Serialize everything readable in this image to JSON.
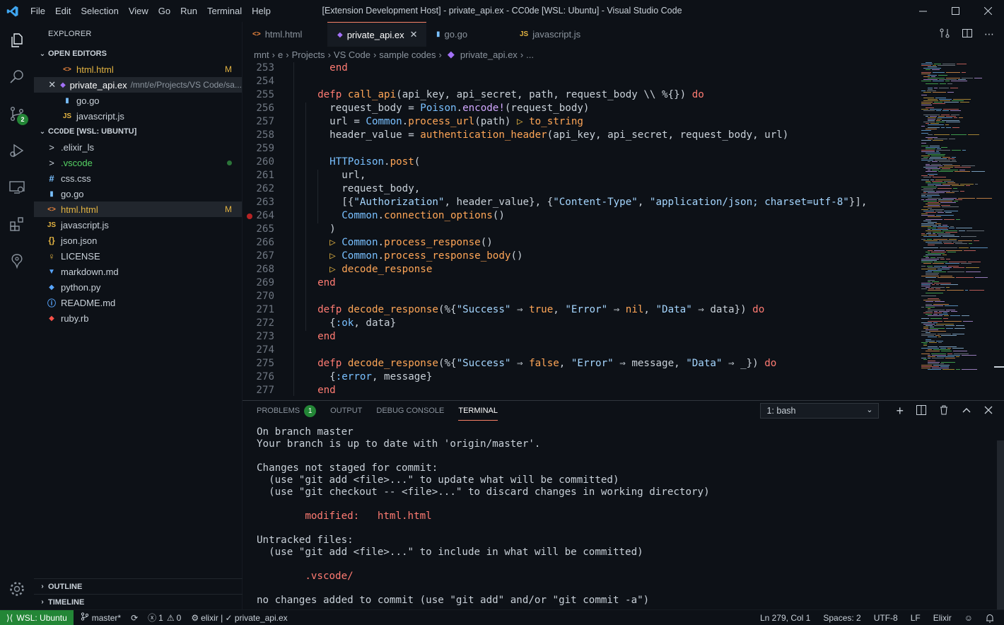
{
  "titlebar": {
    "menu": [
      "File",
      "Edit",
      "Selection",
      "View",
      "Go",
      "Run",
      "Terminal",
      "Help"
    ],
    "title": "[Extension Development Host] - private_api.ex - CC0de [WSL: Ubuntu] - Visual Studio Code"
  },
  "activity": {
    "scm_badge": "2"
  },
  "sidebar": {
    "title": "EXPLORER",
    "open_editors": {
      "label": "OPEN EDITORS",
      "items": [
        {
          "icon": "<>",
          "name": "html.html",
          "badge": "M"
        },
        {
          "icon": "◆",
          "name": "private_api.ex",
          "path": "/mnt/e/Projects/VS Code/sa..."
        },
        {
          "icon": "▮",
          "name": "go.go"
        },
        {
          "icon": "JS",
          "name": "javascript.js"
        }
      ]
    },
    "workspace": {
      "label": "CC0DE [WSL: UBUNTU]",
      "items": [
        {
          "icon": ">",
          "name": ".elixir_ls"
        },
        {
          "icon": ">",
          "name": ".vscode"
        },
        {
          "icon": "#",
          "name": "css.css"
        },
        {
          "icon": "▮",
          "name": "go.go"
        },
        {
          "icon": "<>",
          "name": "html.html",
          "badge": "M"
        },
        {
          "icon": "JS",
          "name": "javascript.js"
        },
        {
          "icon": "{}",
          "name": "json.json"
        },
        {
          "icon": "♀",
          "name": "LICENSE"
        },
        {
          "icon": "▼",
          "name": "markdown.md"
        },
        {
          "icon": "◆",
          "name": "python.py"
        },
        {
          "icon": "ⓘ",
          "name": "README.md"
        },
        {
          "icon": "◆",
          "name": "ruby.rb"
        }
      ]
    },
    "outline": "OUTLINE",
    "timeline": "TIMELINE"
  },
  "tabs": [
    {
      "icon": "<>",
      "label": "html.html"
    },
    {
      "icon": "◆",
      "label": "private_api.ex",
      "close": "✕"
    },
    {
      "icon": "▮",
      "label": "go.go"
    },
    {
      "icon": "JS",
      "label": "javascript.js"
    }
  ],
  "breadcrumbs": [
    "mnt",
    "e",
    "Projects",
    "VS Code",
    "sample codes",
    "private_api.ex",
    "..."
  ],
  "editor": {
    "line_numbers": [
      "253",
      "254",
      "255",
      "256",
      "257",
      "258",
      "259",
      "260",
      "261",
      "262",
      "263",
      "264",
      "265",
      "266",
      "267",
      "268",
      "269",
      "270",
      "271",
      "272",
      "273",
      "274",
      "275",
      "276",
      "277"
    ]
  },
  "panel": {
    "tabs": [
      "PROBLEMS",
      "OUTPUT",
      "DEBUG CONSOLE",
      "TERMINAL"
    ],
    "problems_count": "1",
    "terminal_select": "1: bash",
    "terminal_lines": [
      "On branch master",
      "Your branch is up to date with 'origin/master'.",
      "",
      "Changes not staged for commit:",
      "  (use \"git add <file>...\" to update what will be committed)",
      "  (use \"git checkout -- <file>...\" to discard changes in working directory)",
      "",
      "        modified:   html.html",
      "",
      "Untracked files:",
      "  (use \"git add <file>...\" to include in what will be committed)",
      "",
      "        .vscode/",
      "",
      "no changes added to commit (use \"git add\" and/or \"git commit -a\")"
    ]
  },
  "status": {
    "remote": "WSL: Ubuntu",
    "branch": "master*",
    "errors": "1",
    "warnings": "0",
    "elixir": "elixir | ✓ private_api.ex",
    "position": "Ln 279, Col 1",
    "spaces": "Spaces: 2",
    "encoding": "UTF-8",
    "eol": "LF",
    "language": "Elixir"
  }
}
